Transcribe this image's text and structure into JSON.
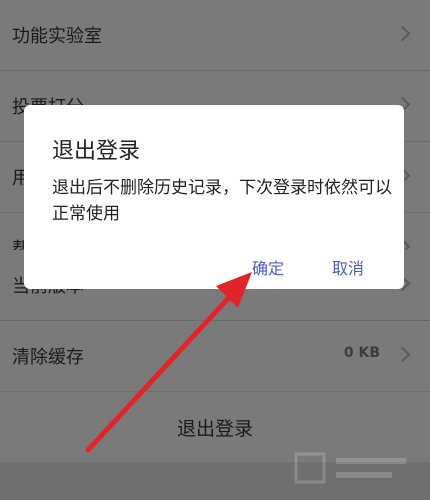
{
  "settings": {
    "items": [
      {
        "label": "功能实验室",
        "value": ""
      },
      {
        "label": "投票打分",
        "value": ""
      },
      {
        "label": "用",
        "value": ""
      },
      {
        "label": "帮",
        "value": ""
      },
      {
        "label": "当前版本",
        "value": ""
      },
      {
        "label": "清除缓存",
        "value": "0 KB"
      }
    ],
    "logout_label": "退出登录"
  },
  "dialog": {
    "title": "退出登录",
    "message": "退出后不删除历史记录，下次登录时依然可以正常使用",
    "confirm_label": "确定",
    "cancel_label": "取消"
  },
  "colors": {
    "accent": "#4b5cc4",
    "arrow": "#e0242a",
    "overlay": "#6f6f6f"
  },
  "icons": [
    "chevron-right-icon",
    "red-arrow-annotation"
  ]
}
